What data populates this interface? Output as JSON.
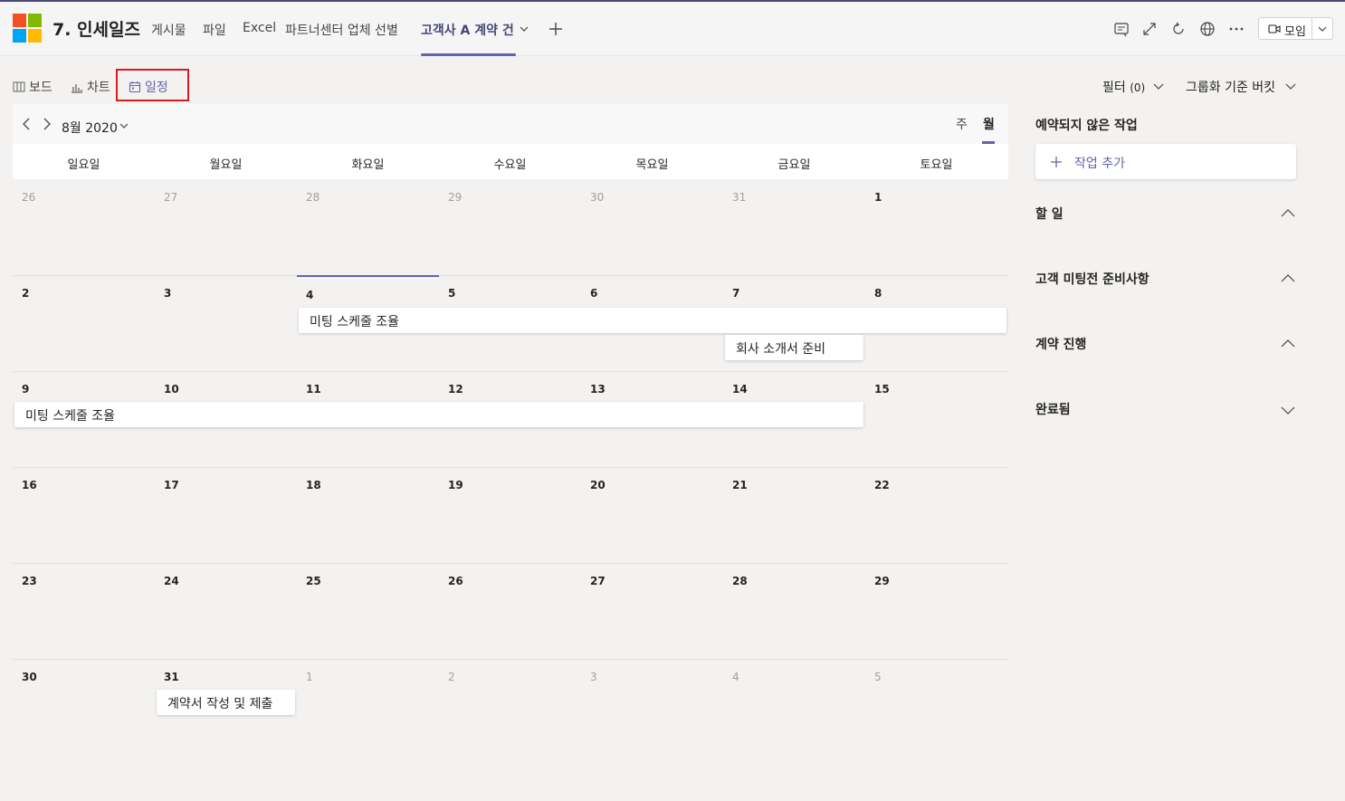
{
  "header": {
    "title": "7. 인세일즈",
    "tabs": [
      {
        "label": "게시물"
      },
      {
        "label": "파일"
      },
      {
        "label": "Excel"
      },
      {
        "label": "파트너센터 업체 선별"
      },
      {
        "label": "고객사 A 계약 건",
        "active": true
      }
    ],
    "meet_label": "모임",
    "icons": [
      "chat-icon",
      "expand-icon",
      "refresh-icon",
      "globe-icon",
      "more-icon"
    ]
  },
  "views": {
    "board": "보드",
    "chart": "차트",
    "schedule": "일정",
    "active": "schedule"
  },
  "filter": {
    "label": "필터",
    "count": "(0)",
    "group_by": "그룹화 기준 버킷"
  },
  "calendar": {
    "month_label": "8월 2020",
    "view_week": "주",
    "view_month": "월",
    "weekdays": [
      "일요일",
      "월요일",
      "화요일",
      "수요일",
      "목요일",
      "금요일",
      "토요일"
    ],
    "weeks": [
      [
        "26",
        "27",
        "28",
        "29",
        "30",
        "31",
        "1"
      ],
      [
        "2",
        "3",
        "4",
        "5",
        "6",
        "7",
        "8"
      ],
      [
        "9",
        "10",
        "11",
        "12",
        "13",
        "14",
        "15"
      ],
      [
        "16",
        "17",
        "18",
        "19",
        "20",
        "21",
        "22"
      ],
      [
        "23",
        "24",
        "25",
        "26",
        "27",
        "28",
        "29"
      ],
      [
        "30",
        "31",
        "1",
        "2",
        "3",
        "4",
        "5"
      ]
    ],
    "tasks": [
      {
        "title": "미팅 스케줄 조율",
        "start": "2020-08-04",
        "end": "2020-08-08"
      },
      {
        "title": "회사 소개서 준비",
        "start": "2020-08-07",
        "end": "2020-08-07"
      },
      {
        "title": "미팅 스케줄 조율",
        "start": "2020-08-09",
        "end": "2020-08-14"
      },
      {
        "title": "계약서 작성 및 제출",
        "start": "2020-08-31",
        "end": "2020-08-31"
      }
    ]
  },
  "panel": {
    "title": "예약되지 않은 작업",
    "add_task": "작업 추가",
    "buckets": [
      {
        "label": "할 일",
        "expanded": true
      },
      {
        "label": "고객 미팅전 준비사항",
        "expanded": true
      },
      {
        "label": "계약 진행",
        "expanded": true
      },
      {
        "label": "완료됨",
        "expanded": false
      }
    ]
  }
}
